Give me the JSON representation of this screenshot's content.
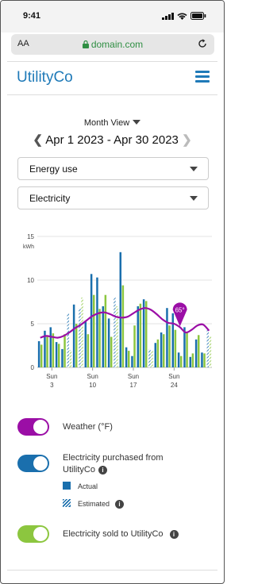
{
  "status": {
    "time": "9:41"
  },
  "browser": {
    "aa": "AA",
    "domain": "domain.com"
  },
  "header": {
    "brand": "UtilityCo"
  },
  "controls": {
    "view_label": "Month View",
    "date_range": "Apr 1 2023 - Apr 30 2023",
    "metric_select": "Energy use",
    "type_select": "Electricity"
  },
  "chart_data": {
    "type": "bar",
    "unit": "kWh",
    "ylim": [
      0,
      15
    ],
    "yticks": [
      0,
      5,
      10,
      15
    ],
    "x_tick_labels": [
      [
        "Sun",
        "3"
      ],
      [
        "Sun",
        "10"
      ],
      [
        "Sun",
        "17"
      ],
      [
        "Sun",
        "24"
      ]
    ],
    "x_tick_days": [
      3,
      10,
      17,
      24
    ],
    "days": [
      1,
      2,
      3,
      4,
      5,
      6,
      7,
      8,
      9,
      10,
      11,
      12,
      13,
      14,
      15,
      16,
      17,
      18,
      19,
      20,
      21,
      22,
      23,
      24,
      25,
      26,
      27,
      28,
      29,
      30
    ],
    "series": [
      {
        "name": "Actual",
        "color": "#1a6fad",
        "values": [
          3.0,
          4.2,
          4.6,
          2.9,
          2.1,
          6.2,
          7.2,
          6.8,
          5.3,
          10.7,
          10.3,
          7.0,
          5.6,
          8.0,
          13.2,
          2.3,
          1.3,
          7.0,
          7.8,
          2.1,
          2.8,
          4.0,
          6.8,
          6.2,
          1.7,
          4.6,
          1.2,
          3.2,
          1.7,
          4.3
        ]
      },
      {
        "name": "Estimated",
        "pattern": true,
        "colors": [
          "#1a6fad",
          "#8cc63f"
        ],
        "days": [
          6,
          8,
          14,
          20,
          30
        ]
      },
      {
        "name": "Electricity sold to UtilityCo",
        "color": "#8cc63f",
        "values": [
          2.6,
          3.5,
          3.9,
          2.7,
          3.8,
          2.0,
          5.0,
          8.0,
          3.8,
          8.3,
          6.7,
          8.3,
          3.5,
          7.0,
          9.4,
          1.9,
          4.8,
          7.3,
          7.6,
          1.9,
          3.2,
          3.8,
          4.8,
          4.3,
          1.3,
          4.1,
          1.6,
          3.7,
          1.6,
          3.5
        ]
      },
      {
        "name": "Weather (°F)",
        "color": "#9b0ea6",
        "line": true,
        "values": [
          3.4,
          3.6,
          3.5,
          3.4,
          3.6,
          4.0,
          4.5,
          4.9,
          5.4,
          5.9,
          6.2,
          6.3,
          6.1,
          5.8,
          5.7,
          5.8,
          6.2,
          6.6,
          6.8,
          6.6,
          6.1,
          5.5,
          5.1,
          5.0,
          4.6,
          4.0,
          4.3,
          4.8,
          4.9,
          4.2
        ]
      }
    ],
    "callout": {
      "day": 25,
      "label": "65°"
    }
  },
  "toggles": [
    {
      "label": "Weather (°F)",
      "color": "#9b0ea6"
    },
    {
      "label": "Electricity purchased from UtilityCo",
      "color": "#1a6fad",
      "legend": [
        {
          "label": "Actual"
        },
        {
          "label": "Estimated"
        }
      ]
    },
    {
      "label": "Electricity sold to UtilityCo",
      "color": "#8cc63f"
    }
  ]
}
